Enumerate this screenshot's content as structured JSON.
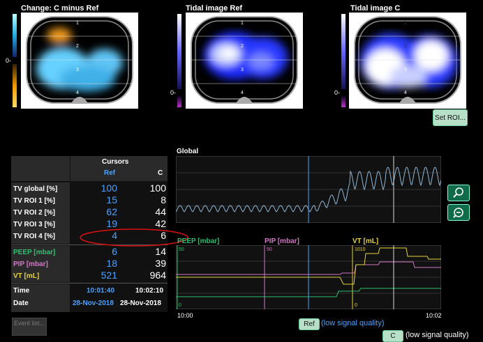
{
  "images": {
    "change_title": "Change: C minus Ref",
    "ref_title": "Tidal image Ref",
    "c_title": "Tidal image C",
    "scale_zero": "0-",
    "rows": [
      "1",
      "2",
      "3",
      "4"
    ]
  },
  "buttons": {
    "set_roi": "Set ROI...",
    "event_list": "Event list...",
    "ref": "Ref",
    "c": "C",
    "ref_quality": "(low signal quality)",
    "c_quality": "(low signal quality)"
  },
  "cursors": {
    "header": "Cursors",
    "col_ref": "Ref",
    "col_c": "C",
    "rows": [
      {
        "label": "TV global [%]",
        "ref": "100",
        "c": "100"
      },
      {
        "label": "TV ROI 1 [%]",
        "ref": "15",
        "c": "8"
      },
      {
        "label": "TV ROI 2 [%]",
        "ref": "62",
        "c": "44"
      },
      {
        "label": "TV ROI 3 [%]",
        "ref": "19",
        "c": "42"
      },
      {
        "label": "TV ROI 4 [%]",
        "ref": "4",
        "c": "6"
      }
    ],
    "vent": [
      {
        "label": "PEEP [mbar]",
        "ref": "6",
        "c": "14",
        "color": "#2fbf71"
      },
      {
        "label": "PIP [mbar]",
        "ref": "18",
        "c": "39",
        "color": "#d377c7"
      },
      {
        "label": "VT [mL]",
        "ref": "521",
        "c": "964",
        "color": "#e6d23a"
      }
    ],
    "time_label": "Time",
    "time_ref": "10:01:40",
    "time_c": "10:02:10",
    "date_label": "Date",
    "date_ref": "28-Nov-2018",
    "date_c": "28-Nov-2018"
  },
  "global_chart": {
    "title": "Global"
  },
  "vent_chart": {
    "peep_label": "PEEP [mbar]",
    "pip_label": "PIP [mbar]",
    "vt_label": "VT [mL]",
    "peep_max": "50",
    "pip_max": "50",
    "vt_max": "1010",
    "peep_min": "0",
    "vt_min": "0",
    "x_start": "10:00",
    "x_end": "10:02"
  }
}
